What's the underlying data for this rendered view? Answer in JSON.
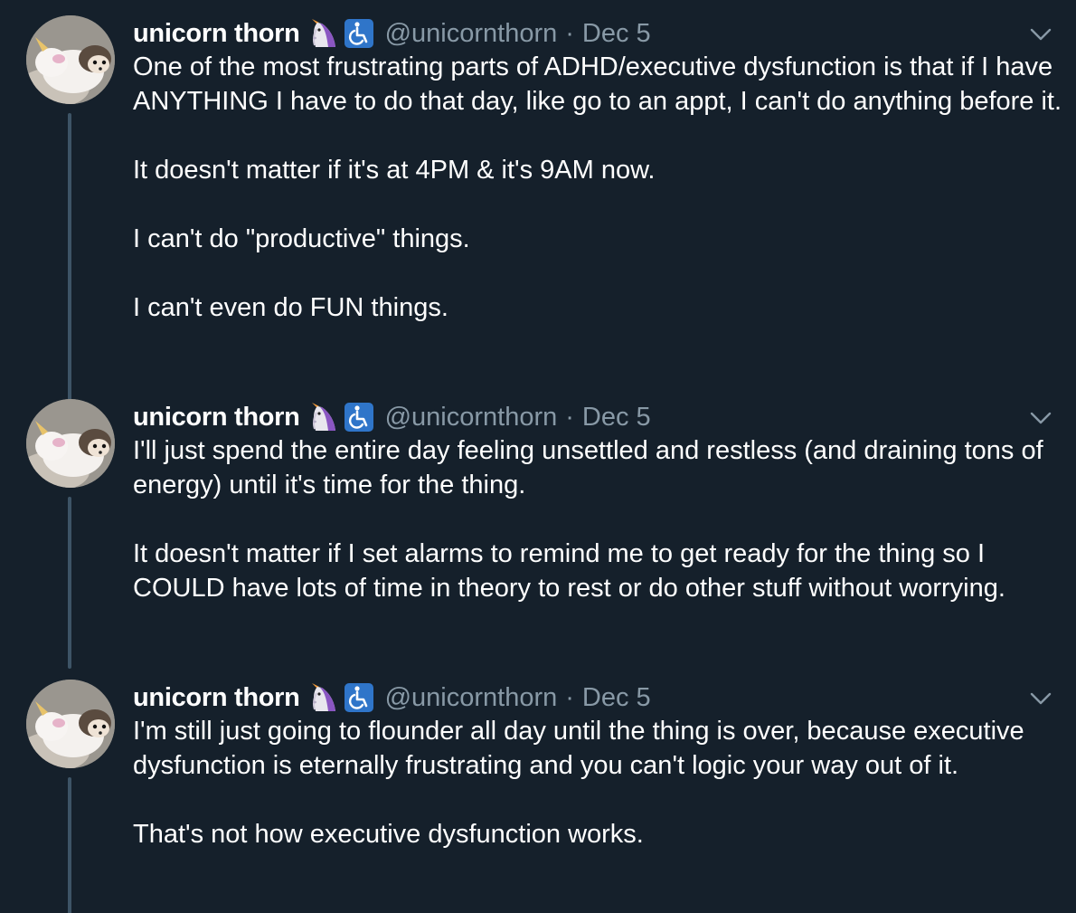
{
  "tweets": [
    {
      "display_name": "unicorn thorn",
      "handle": "@unicornthorn",
      "separator": "·",
      "date": "Dec 5",
      "paragraphs": [
        "One of the most frustrating parts of ADHD/executive dysfunction is that if I have ANYTHING I have to do that day, like go to an appt, I can't do anything before it.",
        "It doesn't matter if it's at 4PM & it's 9AM now.",
        "I can't do \"productive\" things.",
        "I can't even do FUN things."
      ]
    },
    {
      "display_name": "unicorn thorn",
      "handle": "@unicornthorn",
      "separator": "·",
      "date": "Dec 5",
      "paragraphs": [
        "I'll just spend the entire day feeling unsettled and restless (and draining tons of energy) until it's time for the thing.",
        "It doesn't matter if I set alarms to remind me to get ready for the thing so I COULD have lots of time in theory to rest or do other stuff without worrying."
      ]
    },
    {
      "display_name": "unicorn thorn",
      "handle": "@unicornthorn",
      "separator": "·",
      "date": "Dec 5",
      "paragraphs": [
        "I'm still just going to flounder all day until the thing is over, because executive dysfunction is eternally frustrating and you can't logic your way out of it.",
        "That's not how executive dysfunction works."
      ]
    }
  ],
  "icons": {
    "name_badges": [
      "unicorn-icon",
      "wheelchair-icon"
    ],
    "menu": "chevron-down-icon",
    "avatar": "hedgehog-plush-avatar"
  },
  "colors": {
    "background": "#15202b",
    "text_primary": "#ffffff",
    "text_secondary": "#8899a6",
    "thread_line": "#3d5466",
    "accessibility_badge": "#2f75c9"
  }
}
